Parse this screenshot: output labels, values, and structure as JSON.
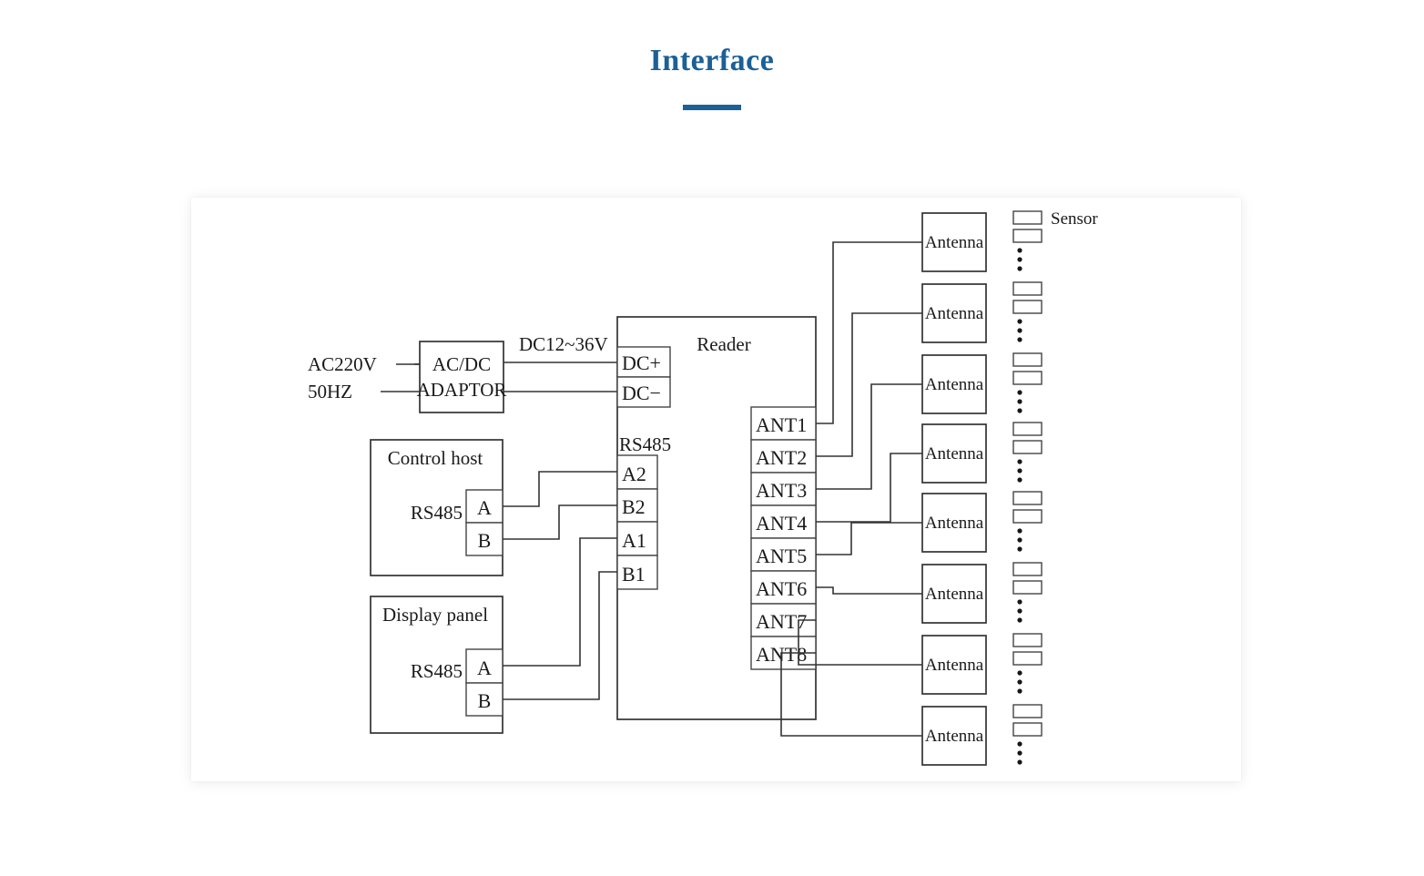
{
  "header": {
    "title": "Interface",
    "accent_color": "#1b6097",
    "rule": "title-underline-bar"
  },
  "diagram": {
    "name": "rfid-reader-interface-wiring-diagram",
    "power": {
      "ac_input_line1": "AC220V",
      "ac_input_line2": "50HZ",
      "adaptor_line1": "AC/DC",
      "adaptor_line2": "ADAPTOR",
      "dc_output_label": "DC12~36V"
    },
    "reader": {
      "title": "Reader",
      "power_terminals": [
        "DC+",
        "DC−"
      ],
      "rs485_label": "RS485",
      "rs485_terminals": [
        "A2",
        "B2",
        "A1",
        "B1"
      ],
      "ant_terminals": [
        "ANT1",
        "ANT2",
        "ANT3",
        "ANT4",
        "ANT5",
        "ANT6",
        "ANT7",
        "ANT8"
      ]
    },
    "control_host": {
      "title": "Control host",
      "bus_label": "RS485",
      "terminals": [
        "A",
        "B"
      ]
    },
    "display_panel": {
      "title": "Display panel",
      "bus_label": "RS485",
      "terminals": [
        "A",
        "B"
      ]
    },
    "antennas": {
      "label": "Antenna",
      "count": 8
    },
    "sensors": {
      "label": "Sensor",
      "groups": 8,
      "boxes_per_group": 2,
      "dots_per_group": 3
    }
  }
}
